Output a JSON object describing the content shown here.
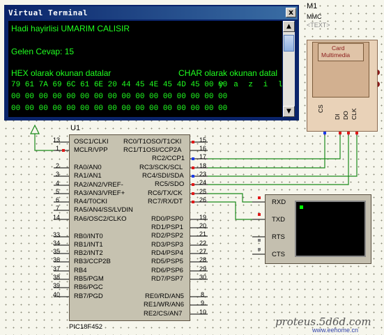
{
  "terminal": {
    "title": "Virtual Terminal",
    "close": "x",
    "lines": [
      {
        "text": "Hadi hayirlisi UMARIM CALISIR"
      },
      {
        "text": "Gelen Cevap: 15"
      },
      {
        "hex_header": "HEX olarak okunan datalar",
        "char_header": "CHAR olarak okunan datal"
      },
      {
        "hex": "79 61 7A 69 6C 61 6E 20 44 45 4E 45 4D 45 00 00",
        "chars": "y a z i l a n  D"
      },
      {
        "hex": "00 00 00 00 00 00 00 00 00 00 00 00 00 00 00 00"
      },
      {
        "hex": "00 00 00 00 00 00 00 00 00 00 00 00 00 00 00 00"
      }
    ],
    "scroll_up": "▲",
    "scroll_down": "▼"
  },
  "mcu": {
    "ref": "U1",
    "part": "PIC18F452",
    "part_below": "<TEXT>",
    "left_pins": [
      {
        "num": "13",
        "name": "OSC1/CLKI"
      },
      {
        "num": "1",
        "name": "MCLR/VPP"
      },
      {
        "num": "2",
        "name": "RA0/AN0"
      },
      {
        "num": "3",
        "name": "RA1/AN1"
      },
      {
        "num": "4",
        "name": "RA2/AN2/VREF-"
      },
      {
        "num": "5",
        "name": "RA3/AN3/VREF+"
      },
      {
        "num": "6",
        "name": "RA4/T0CKI"
      },
      {
        "num": "7",
        "name": "RA5/AN4/SS/LVDIN"
      },
      {
        "num": "14",
        "name": "RA6/OSC2/CLKO"
      },
      {
        "num": "33",
        "name": "RB0/INT0"
      },
      {
        "num": "34",
        "name": "RB1/INT1"
      },
      {
        "num": "35",
        "name": "RB2/INT2"
      },
      {
        "num": "36",
        "name": "RB3/CCP2B"
      },
      {
        "num": "37",
        "name": "RB4"
      },
      {
        "num": "38",
        "name": "RB5/PGM"
      },
      {
        "num": "39",
        "name": "RB6/PGC"
      },
      {
        "num": "40",
        "name": "RB7/PGD"
      }
    ],
    "right_pins": [
      {
        "num": "15",
        "name": "RC0/T1OSO/T1CKI"
      },
      {
        "num": "16",
        "name": "RC1/T1OSI/CCP2A"
      },
      {
        "num": "17",
        "name": "RC2/CCP1"
      },
      {
        "num": "18",
        "name": "RC3/SCK/SCL"
      },
      {
        "num": "23",
        "name": "RC4/SDI/SDA"
      },
      {
        "num": "24",
        "name": "RC5/SDO"
      },
      {
        "num": "25",
        "name": "RC6/TX/CK"
      },
      {
        "num": "26",
        "name": "RC7/RX/DT"
      },
      {
        "num": "19",
        "name": "RD0/PSP0"
      },
      {
        "num": "20",
        "name": "RD1/PSP1"
      },
      {
        "num": "21",
        "name": "RD2/PSP2"
      },
      {
        "num": "22",
        "name": "RD3/PSP3"
      },
      {
        "num": "27",
        "name": "RD4/PSP4"
      },
      {
        "num": "28",
        "name": "RD5/PSP5"
      },
      {
        "num": "29",
        "name": "RD6/PSP6"
      },
      {
        "num": "30",
        "name": "RD7/PSP7"
      },
      {
        "num": "8",
        "name": "RE0/RD/AN5"
      },
      {
        "num": "9",
        "name": "RE1/WR/AN6"
      },
      {
        "num": "10",
        "name": "RE2/CS/AN7"
      }
    ]
  },
  "mmc": {
    "ref": "M1",
    "part": "MMC",
    "text": "<TEXT>",
    "card_line1": "Card",
    "card_line2": "Multimedia",
    "pins": [
      "CS",
      "DI",
      "DO",
      "CLK"
    ]
  },
  "vterm_component": {
    "pins": [
      "RXD",
      "TXD",
      "RTS",
      "CTS"
    ]
  },
  "watermark": {
    "brand": "proteus.5d6d.com",
    "site": "www.eehome.cn"
  },
  "colors": {
    "wire": "#1a8a1a",
    "pin_red": "#e01818",
    "pin_blue": "#1a3ae8",
    "pin_gray": "#808080",
    "terminal_text": "#20ff20",
    "terminal_led": "#00ff00"
  }
}
